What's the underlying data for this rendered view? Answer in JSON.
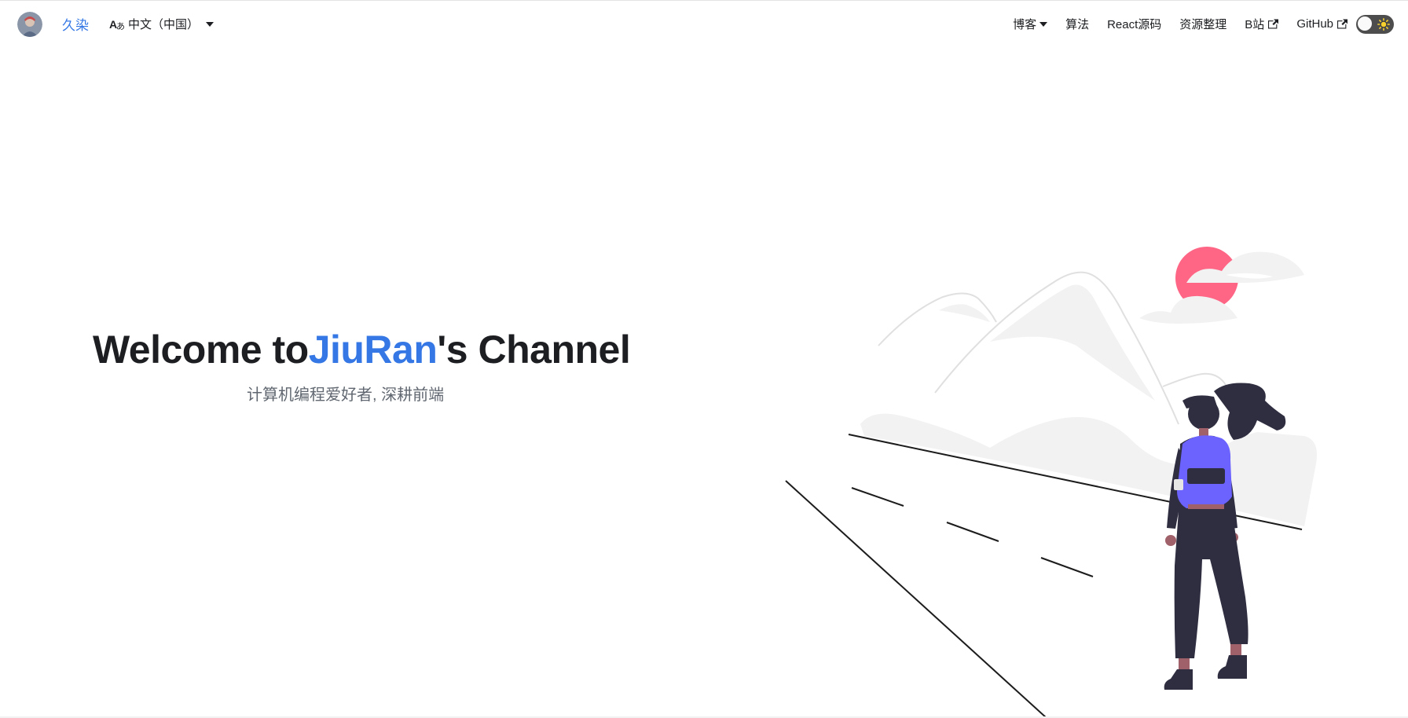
{
  "navbar": {
    "brand": "久染",
    "language": "中文（中国）",
    "links": [
      "博客",
      "算法",
      "React源码",
      "资源整理",
      "B站",
      "GitHub"
    ]
  },
  "hero": {
    "title_prefix": "Welcome to",
    "title_highlight": "JiuRan",
    "title_suffix": "'s Channel",
    "subtitle": "计算机编程爱好者, 深耕前端"
  },
  "colors": {
    "accent": "#3578e5",
    "text": "#1c1e21",
    "sun": "#ff6584",
    "backpack": "#6c63ff",
    "figure": "#2f2e41"
  },
  "icons": {
    "language": "translate-icon",
    "external": "external-link-icon",
    "theme": "sun-icon"
  }
}
